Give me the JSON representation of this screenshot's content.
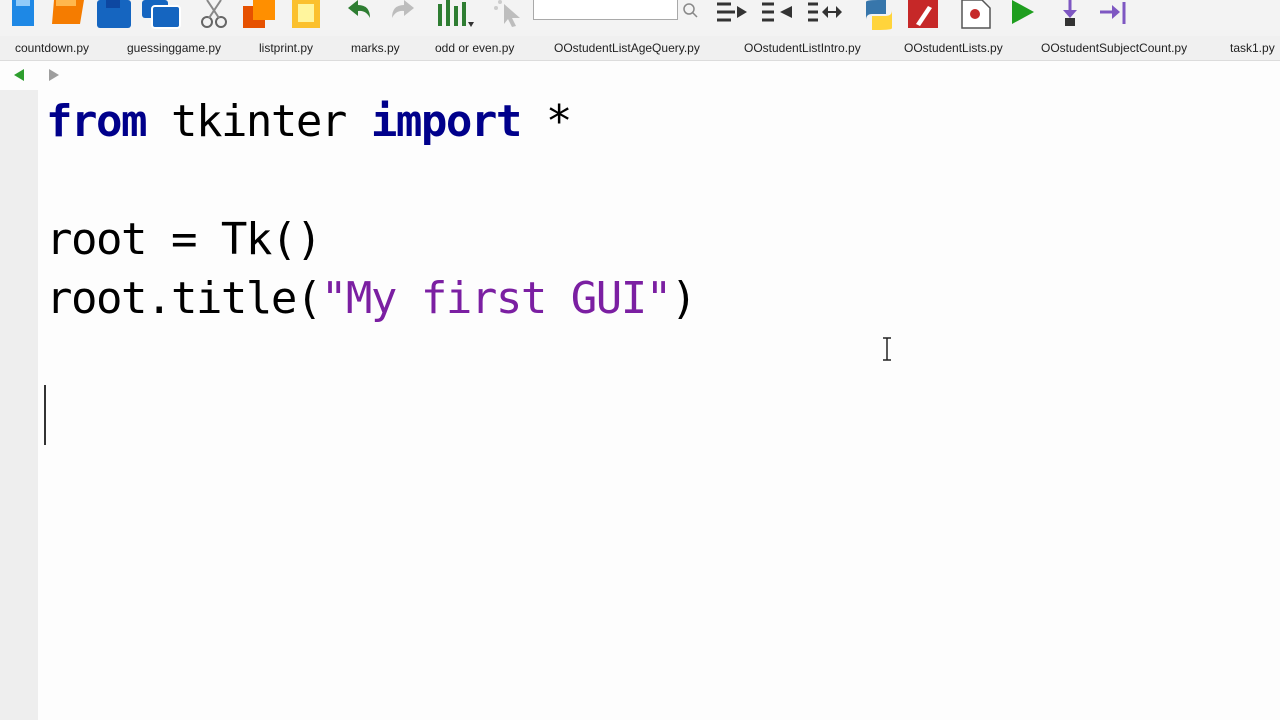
{
  "toolbar": {
    "buttons": [
      {
        "name": "new-file-icon",
        "color": "#1e88e5"
      },
      {
        "name": "open-folder-icon",
        "color": "#f57c00"
      },
      {
        "name": "save-icon",
        "color": "#1565c0"
      },
      {
        "name": "save-all-icon",
        "color": "#1565c0"
      },
      {
        "name": "cut-icon",
        "color": "#666666"
      },
      {
        "name": "copy-icon",
        "color": "#e65100"
      },
      {
        "name": "paste-icon",
        "color": "#fbc02d"
      },
      {
        "name": "undo-icon",
        "color": "#2e7d32"
      },
      {
        "name": "redo-icon",
        "color": "#bdbdbd"
      },
      {
        "name": "find-icon",
        "color": "#2e7d32"
      },
      {
        "name": "pointer-icon",
        "color": "#bdbdbd"
      },
      {
        "name": "search-icon",
        "color": "#888888"
      },
      {
        "name": "indent-icon",
        "color": "#333333"
      },
      {
        "name": "dedent-icon",
        "color": "#333333"
      },
      {
        "name": "toggle-indent-icon",
        "color": "#333333"
      },
      {
        "name": "python-icon",
        "color": "#3776ab"
      },
      {
        "name": "settings-icon",
        "color": "#c62828"
      },
      {
        "name": "breakpoint-icon",
        "color": "#c62828"
      },
      {
        "name": "run-icon",
        "color": "#1e9e1e"
      },
      {
        "name": "step-into-icon",
        "color": "#7e57c2"
      },
      {
        "name": "step-out-icon",
        "color": "#7e57c2"
      }
    ],
    "search_value": ""
  },
  "tabs": [
    {
      "label": "countdown.py"
    },
    {
      "label": "guessinggame.py"
    },
    {
      "label": "listprint.py"
    },
    {
      "label": "marks.py"
    },
    {
      "label": "odd or even.py"
    },
    {
      "label": "OOstudentListAgeQuery.py"
    },
    {
      "label": "OOstudentListIntro.py"
    },
    {
      "label": "OOstudentLists.py"
    },
    {
      "label": "OOstudentSubjectCount.py"
    },
    {
      "label": "task1.py"
    }
  ],
  "nav": {
    "back_icon": "back-arrow-icon",
    "forward_icon": "forward-arrow-icon",
    "back_color": "#2e9e2e",
    "forward_color": "#9e9e9e"
  },
  "code": {
    "line1": {
      "kw1": "from",
      "mod": " tkinter ",
      "kw2": "import",
      "rest": " *"
    },
    "line3": {
      "text": "root = Tk()"
    },
    "line4": {
      "pre": "root.title(",
      "str": "\"My first GUI\"",
      "post": ")"
    }
  }
}
